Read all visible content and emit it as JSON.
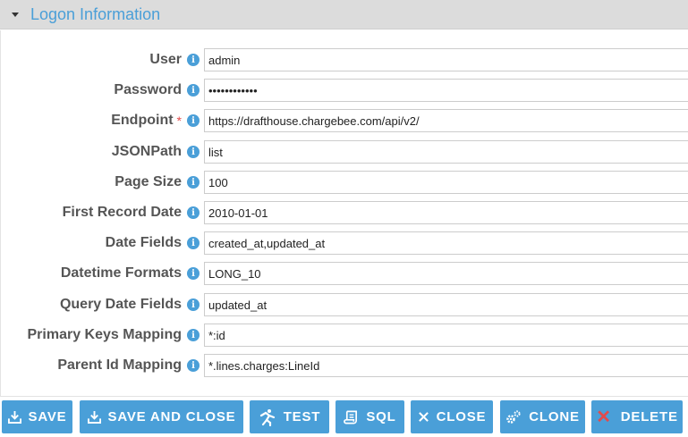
{
  "section": {
    "title": "Logon Information"
  },
  "fields": [
    {
      "label": "User",
      "value": "admin",
      "required": false
    },
    {
      "label": "Password",
      "value": "••••••••••••",
      "required": false
    },
    {
      "label": "Endpoint",
      "value": "https://drafthouse.chargebee.com/api/v2/",
      "required": true
    },
    {
      "label": "JSONPath",
      "value": "list",
      "required": false
    },
    {
      "label": "Page Size",
      "value": "100",
      "required": false
    },
    {
      "label": "First Record Date",
      "value": "2010-01-01",
      "required": false
    },
    {
      "label": "Date Fields",
      "value": "created_at,updated_at",
      "required": false
    },
    {
      "label": "Datetime Formats",
      "value": "LONG_10",
      "required": false
    },
    {
      "label": "Query Date Fields",
      "value": "updated_at",
      "required": false
    },
    {
      "label": "Primary Keys Mapping",
      "value": "*:id",
      "required": false
    },
    {
      "label": "Parent Id Mapping",
      "value": "*.lines.charges:LineId",
      "required": false
    }
  ],
  "required_marker": "*",
  "info_glyph": "i",
  "toolbar": {
    "save": "SAVE",
    "save_and_close": "SAVE AND CLOSE",
    "test": "TEST",
    "sql": "SQL",
    "close": "CLOSE",
    "clone": "CLONE",
    "delete": "DELETE",
    "delete_glyph": "✕"
  },
  "colors": {
    "accent": "#4a9fd8",
    "header_bg": "#dcdcdc",
    "required": "#e24b4b",
    "label": "#555555"
  }
}
